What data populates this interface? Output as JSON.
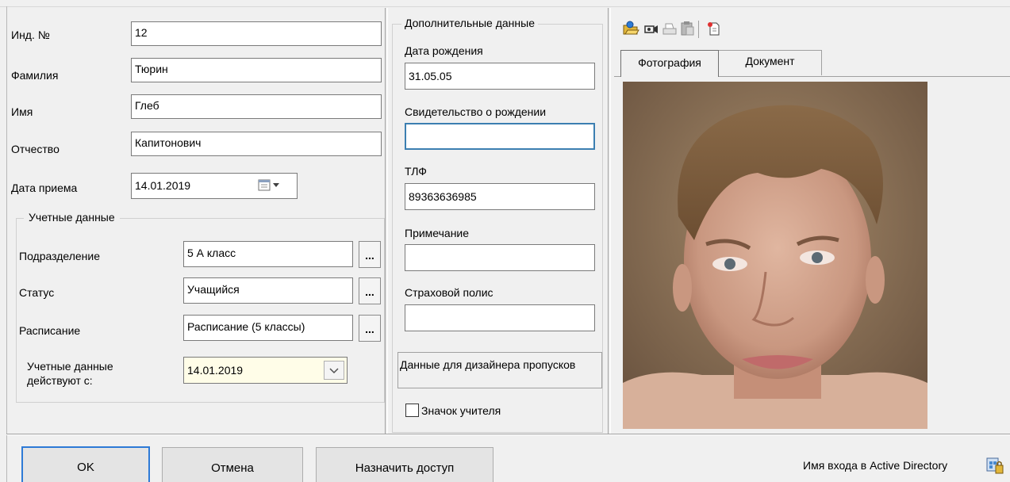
{
  "left": {
    "id_label": "Инд. №",
    "id_value": "12",
    "lastname_label": "Фамилия",
    "lastname_value": "Тюрин",
    "firstname_label": "Имя",
    "firstname_value": "Глеб",
    "patronymic_label": "Отчество",
    "patronymic_value": "Капитонович",
    "hire_date_label": "Дата приема",
    "hire_date_value": "14.01.2019",
    "account_group_title": "Учетные данные",
    "division_label": "Подразделение",
    "division_value": "5 А класс",
    "status_label": "Статус",
    "status_value": "Учащийся",
    "schedule_label": "Расписание",
    "schedule_value": "Расписание (5 классы)",
    "valid_from_label_line1": "Учетные данные",
    "valid_from_label_line2": "действуют с:",
    "valid_from_value": "14.01.2019",
    "ellipsis": "..."
  },
  "middle": {
    "group_title": "Дополнительные данные",
    "birth_date_label": "Дата рождения",
    "birth_date_value": "31.05.05",
    "birth_cert_label": "Свидетельство о рождении",
    "birth_cert_value": "",
    "phone_label": "ТЛФ",
    "phone_value": "89363636985",
    "note_label": "Примечание",
    "note_value": "",
    "insurance_label": "Страховой полис",
    "insurance_value": "",
    "designer_button": "Данные для дизайнера пропусков",
    "teacher_badge_label": "Значок учителя",
    "teacher_badge_checked": false
  },
  "right": {
    "tabs": [
      "Фотография",
      "Документ"
    ],
    "active_tab": "Фотография",
    "toolbar_icons": [
      "open-photo-icon",
      "camera-icon",
      "print-icon",
      "paste-icon",
      "new-document-icon"
    ]
  },
  "footer": {
    "ok": "OK",
    "cancel": "Отмена",
    "assign_access": "Назначить доступ",
    "ad_login_label": "Имя входа в Active Directory"
  },
  "colors": {
    "window_bg": "#f0f0f0",
    "focus_border": "#3c7fb1",
    "default_button_border": "#2d7ad6",
    "date_highlight": "#fffde8"
  }
}
